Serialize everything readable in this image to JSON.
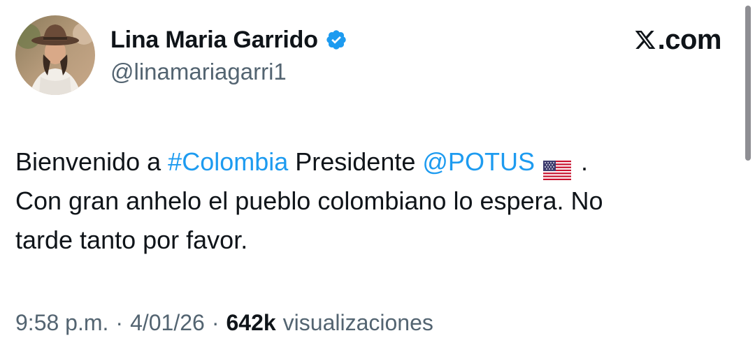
{
  "author": {
    "display_name": "Lina Maria Garrido",
    "handle": "@linamariagarri1",
    "verified": true,
    "avatar_icon": "profile-photo"
  },
  "brand": {
    "text": "X.com",
    "suffix": ".com",
    "icon": "x-logo-icon"
  },
  "tweet": {
    "line1": {
      "part1": "Bienvenido a ",
      "hashtag": "#Colombia",
      "part2": " Presidente ",
      "mention": "@POTUS",
      "flag_icon": "us-flag-icon",
      "part3": " ."
    },
    "line2": "Con gran anhelo el pueblo colombiano lo espera. No",
    "line3": "tarde tanto por favor."
  },
  "meta": {
    "time": "9:58 p.m.",
    "separator": "·",
    "date": "4/01/26",
    "views_count": "642k",
    "views_label": "visualizaciones"
  },
  "colors": {
    "link": "#1d9bf0",
    "verified_badge": "#1d9bf0",
    "secondary_text": "#536471",
    "primary_text": "#0f1419"
  }
}
